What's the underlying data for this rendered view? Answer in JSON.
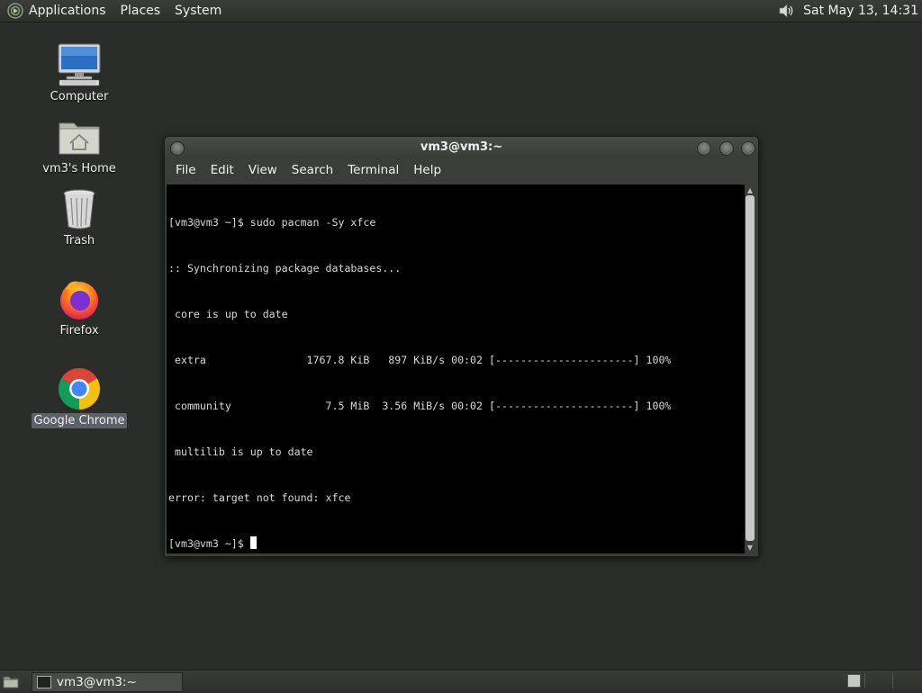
{
  "top_panel": {
    "menus": [
      "Applications",
      "Places",
      "System"
    ],
    "clock": "Sat May 13, 14:31"
  },
  "desktop": {
    "icons": [
      {
        "label": "Computer"
      },
      {
        "label": "vm3's Home"
      },
      {
        "label": "Trash"
      },
      {
        "label": "Firefox"
      },
      {
        "label": "Google Chrome"
      }
    ]
  },
  "window": {
    "title": "vm3@vm3:~",
    "menu": [
      "File",
      "Edit",
      "View",
      "Search",
      "Terminal",
      "Help"
    ],
    "terminal_lines": [
      "[vm3@vm3 ~]$ sudo pacman -Sy xfce",
      ":: Synchronizing package databases...",
      " core is up to date",
      " extra                1767.8 KiB   897 KiB/s 00:02 [----------------------] 100%",
      " community               7.5 MiB  3.56 MiB/s 00:02 [----------------------] 100%",
      " multilib is up to date",
      "error: target not found: xfce",
      "[vm3@vm3 ~]$ "
    ]
  },
  "taskbar": {
    "tasks": [
      {
        "label": "vm3@vm3:~"
      }
    ]
  },
  "colors": {
    "desktop_bg": "#2b2d2a",
    "terminal_bg": "#000000",
    "terminal_fg": "#d9d9d9"
  }
}
